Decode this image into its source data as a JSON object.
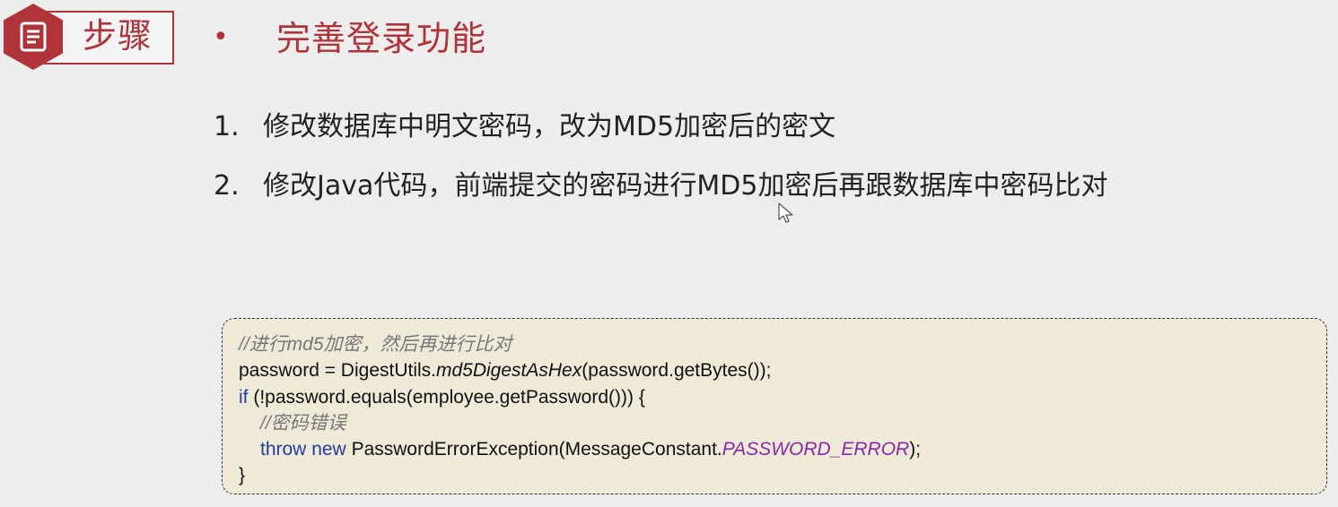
{
  "header": {
    "badge_label": "步骤",
    "bullet": "•",
    "title": "完善登录功能"
  },
  "steps": [
    {
      "number": "1.",
      "text": "修改数据库中明文密码，改为MD5加密后的密文"
    },
    {
      "number": "2.",
      "text": "修改Java代码，前端提交的密码进行MD5加密后再跟数据库中密码比对"
    }
  ],
  "code": {
    "line1_comment": "//进行md5加密，然后再进行比对",
    "line2_a": "password = DigestUtils.",
    "line2_b": "md5DigestAsHex",
    "line2_c": "(password.getBytes());",
    "line3_kw": "if",
    "line3_rest": " (!password.equals(employee.getPassword())) {",
    "line4_comment": "//密码错误",
    "line5_kw1": "throw",
    "line5_sp": " ",
    "line5_kw2": "new",
    "line5_rest": " PasswordErrorException(MessageConstant.",
    "line5_const": "PASSWORD_ERROR",
    "line5_end": ");",
    "line6": "}"
  },
  "colors": {
    "accent": "#b0333a",
    "code_keyword": "#1f3fa0",
    "code_constant": "#8a2aa8",
    "code_comment": "#777777",
    "code_background": "#efe9d8"
  },
  "icons": {
    "badge": "document-icon",
    "pointer": "mouse-cursor-icon"
  }
}
